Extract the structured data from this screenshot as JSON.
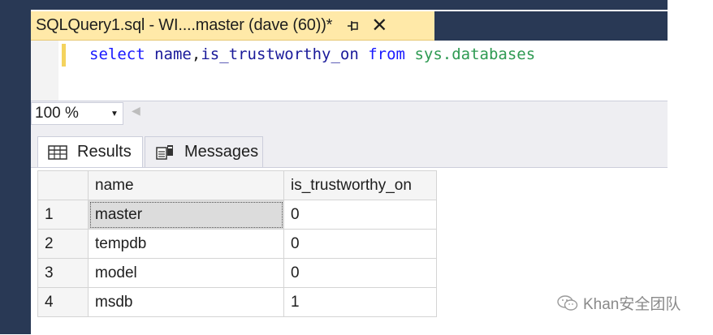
{
  "document_tab": {
    "title": "SQLQuery1.sql - WI....master (dave (60))*",
    "pin_glyph": "⊣",
    "close_glyph": "✕"
  },
  "editor": {
    "tokens": {
      "select": "select",
      "name": "name",
      "comma": ",",
      "column2": "is_trustworthy_on",
      "from": "from",
      "object": "sys.databases"
    }
  },
  "zoom": {
    "value": "100 %"
  },
  "results_tabs": [
    {
      "label": "Results",
      "icon": "grid-icon",
      "active": true
    },
    {
      "label": "Messages",
      "icon": "messages-icon",
      "active": false
    }
  ],
  "grid": {
    "columns": [
      "name",
      "is_trustworthy_on"
    ],
    "rows": [
      {
        "num": "1",
        "name": "master",
        "is_trustworthy_on": "0"
      },
      {
        "num": "2",
        "name": "tempdb",
        "is_trustworthy_on": "0"
      },
      {
        "num": "3",
        "name": "model",
        "is_trustworthy_on": "0"
      },
      {
        "num": "4",
        "name": "msdb",
        "is_trustworthy_on": "1"
      }
    ]
  },
  "watermark": {
    "text": "Khan安全团队",
    "icon": "wechat-icon"
  },
  "colors": {
    "frame": "#293955",
    "active_tab": "#ffe9a8",
    "keyword": "#1a1aff",
    "object": "#2e9a52"
  }
}
